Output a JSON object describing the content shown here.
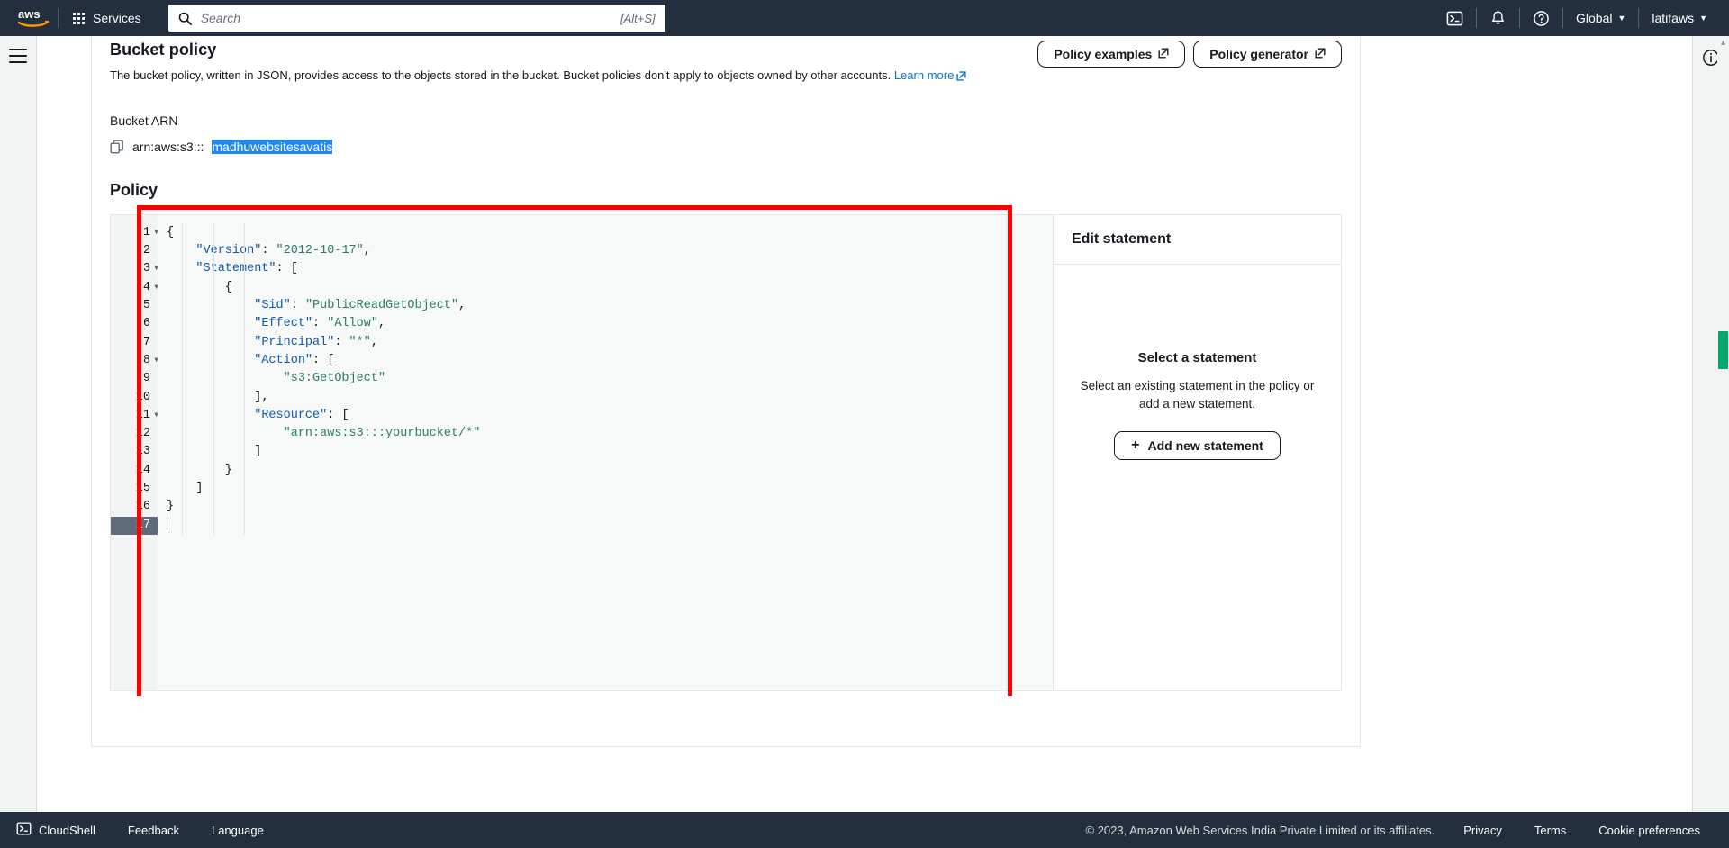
{
  "topnav": {
    "logo_alt": "aws",
    "services_label": "Services",
    "search_placeholder": "Search",
    "search_value": "",
    "search_shortcut": "[Alt+S]",
    "cloudshell_icon": "cloudshell-icon",
    "notifications_icon": "bell-icon",
    "help_icon": "question-circle-icon",
    "region_label": "Global",
    "account_label": "latifaws"
  },
  "page": {
    "title": "Bucket policy",
    "description": "The bucket policy, written in JSON, provides access to the objects stored in the bucket. Bucket policies don't apply to objects owned by other accounts.",
    "learn_more": "Learn more",
    "policy_examples_btn": "Policy examples",
    "policy_generator_btn": "Policy generator",
    "bucket_arn_label": "Bucket ARN",
    "bucket_arn_prefix": "arn:aws:s3:::",
    "bucket_arn_selected": "madhuwebsitesavatis",
    "policy_label": "Policy"
  },
  "editor": {
    "active_line": 17,
    "total_lines": 17,
    "lines": [
      {
        "n": 1,
        "fold": true,
        "tokens": [
          {
            "t": "p",
            "v": "{"
          }
        ]
      },
      {
        "n": 2,
        "fold": false,
        "tokens": [
          {
            "t": "p",
            "v": "    "
          },
          {
            "t": "k",
            "v": "\"Version\""
          },
          {
            "t": "p",
            "v": ": "
          },
          {
            "t": "s",
            "v": "\"2012-10-17\""
          },
          {
            "t": "p",
            "v": ","
          }
        ]
      },
      {
        "n": 3,
        "fold": true,
        "tokens": [
          {
            "t": "p",
            "v": "    "
          },
          {
            "t": "k",
            "v": "\"Statement\""
          },
          {
            "t": "p",
            "v": ": ["
          }
        ]
      },
      {
        "n": 4,
        "fold": true,
        "tokens": [
          {
            "t": "p",
            "v": "        {"
          }
        ]
      },
      {
        "n": 5,
        "fold": false,
        "tokens": [
          {
            "t": "p",
            "v": "            "
          },
          {
            "t": "k",
            "v": "\"Sid\""
          },
          {
            "t": "p",
            "v": ": "
          },
          {
            "t": "s",
            "v": "\"PublicReadGetObject\""
          },
          {
            "t": "p",
            "v": ","
          }
        ]
      },
      {
        "n": 6,
        "fold": false,
        "tokens": [
          {
            "t": "p",
            "v": "            "
          },
          {
            "t": "k",
            "v": "\"Effect\""
          },
          {
            "t": "p",
            "v": ": "
          },
          {
            "t": "s",
            "v": "\"Allow\""
          },
          {
            "t": "p",
            "v": ","
          }
        ]
      },
      {
        "n": 7,
        "fold": false,
        "tokens": [
          {
            "t": "p",
            "v": "            "
          },
          {
            "t": "k",
            "v": "\"Principal\""
          },
          {
            "t": "p",
            "v": ": "
          },
          {
            "t": "s",
            "v": "\"*\""
          },
          {
            "t": "p",
            "v": ","
          }
        ]
      },
      {
        "n": 8,
        "fold": true,
        "tokens": [
          {
            "t": "p",
            "v": "            "
          },
          {
            "t": "k",
            "v": "\"Action\""
          },
          {
            "t": "p",
            "v": ": ["
          }
        ]
      },
      {
        "n": 9,
        "fold": false,
        "tokens": [
          {
            "t": "p",
            "v": "                "
          },
          {
            "t": "s",
            "v": "\"s3:GetObject\""
          }
        ]
      },
      {
        "n": 10,
        "fold": false,
        "tokens": [
          {
            "t": "p",
            "v": "            ],"
          }
        ]
      },
      {
        "n": 11,
        "fold": true,
        "tokens": [
          {
            "t": "p",
            "v": "            "
          },
          {
            "t": "k",
            "v": "\"Resource\""
          },
          {
            "t": "p",
            "v": ": ["
          }
        ]
      },
      {
        "n": 12,
        "fold": false,
        "tokens": [
          {
            "t": "p",
            "v": "                "
          },
          {
            "t": "s",
            "v": "\"arn:aws:s3:::yourbucket/*\""
          }
        ]
      },
      {
        "n": 13,
        "fold": false,
        "tokens": [
          {
            "t": "p",
            "v": "            ]"
          }
        ]
      },
      {
        "n": 14,
        "fold": false,
        "tokens": [
          {
            "t": "p",
            "v": "        }"
          }
        ]
      },
      {
        "n": 15,
        "fold": false,
        "tokens": [
          {
            "t": "p",
            "v": "    ]"
          }
        ]
      },
      {
        "n": 16,
        "fold": false,
        "tokens": [
          {
            "t": "p",
            "v": "}"
          }
        ]
      },
      {
        "n": 17,
        "fold": false,
        "tokens": []
      }
    ]
  },
  "side_panel": {
    "header": "Edit statement",
    "empty_title": "Select a statement",
    "empty_desc": "Select an existing statement in the policy or add a new statement.",
    "add_button": "Add new statement"
  },
  "footer": {
    "cloudshell": "CloudShell",
    "feedback": "Feedback",
    "language": "Language",
    "copyright": "© 2023, Amazon Web Services India Private Limited or its affiliates.",
    "privacy": "Privacy",
    "terms": "Terms",
    "cookies": "Cookie preferences"
  },
  "colors": {
    "nav_bg": "#232f3e",
    "link": "#0972d3",
    "selection": "#2188f3",
    "annotation": "#ff0000",
    "json_key": "#0d5aa7",
    "json_string": "#2a7a6a",
    "scroll_thumb": "#00a86b"
  }
}
